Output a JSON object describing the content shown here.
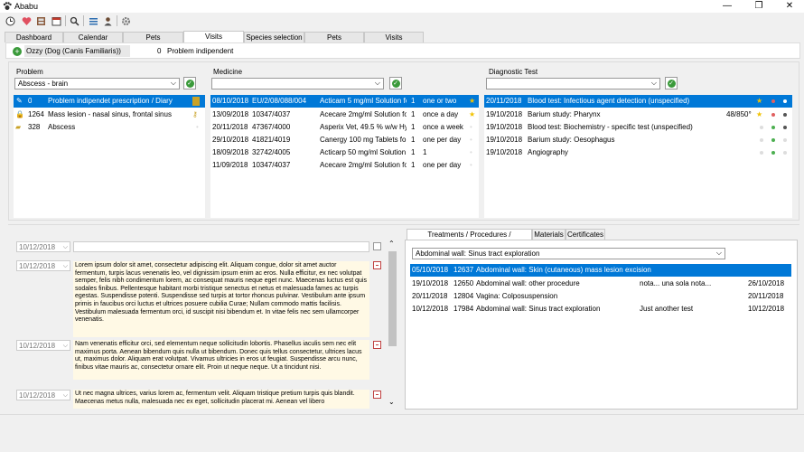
{
  "window": {
    "title": "Ababu",
    "min": "—",
    "max": "❐",
    "close": "✕"
  },
  "tabs": [
    "Dashboard",
    "Calendar",
    "Pets",
    "Visits",
    "Species selection",
    "Pets",
    "Visits"
  ],
  "patient": {
    "name": "Ozzy (Dog (Canis Familiaris))",
    "problem_id": "0",
    "problem": "Problem indipendent"
  },
  "problem": {
    "label": "Problem",
    "selected": "Abscess - brain",
    "rows": [
      {
        "id": "0",
        "name": "Problem indipendet prescription / Diary"
      },
      {
        "id": "1264",
        "name": "Mass lesion - nasal sinus, frontal sinus"
      },
      {
        "id": "328",
        "name": "Abscess"
      }
    ]
  },
  "medicine": {
    "label": "Medicine",
    "selected": "",
    "rows": [
      {
        "date": "08/10/2018",
        "code": "EU/2/08/088/004",
        "name": "Acticam 5 mg/ml Solution fo",
        "qty": "1",
        "freq": "one or two"
      },
      {
        "date": "13/09/2018",
        "code": "10347/4037",
        "name": "Acecare 2mg/ml Solution for I",
        "qty": "1",
        "freq": "once a day"
      },
      {
        "date": "20/11/2018",
        "code": "47367/4000",
        "name": "Asperix Vet, 49.5 % w/w Hyd",
        "qty": "1",
        "freq": "once a week"
      },
      {
        "date": "29/10/2018",
        "code": "41821/4019",
        "name": "Canergy 100 mg Tablets for",
        "qty": "1",
        "freq": "one per day"
      },
      {
        "date": "18/09/2018",
        "code": "32742/4005",
        "name": "Acticarp 50 mg/ml Solution fo",
        "qty": "1",
        "freq": "1"
      },
      {
        "date": "11/09/2018",
        "code": "10347/4037",
        "name": "Acecare 2mg/ml Solution for I",
        "qty": "1",
        "freq": "one per day"
      }
    ]
  },
  "diagnostic": {
    "label": "Diagnostic Test",
    "selected": "",
    "rows": [
      {
        "date": "20/11/2018",
        "name": "Blood test: Infectious agent detection (unspecified)",
        "value": ""
      },
      {
        "date": "19/10/2018",
        "name": "Barium study: Pharynx",
        "value": "48/850°"
      },
      {
        "date": "19/10/2018",
        "name": "Blood test: Biochemistry - specific test (unspecified)",
        "value": ""
      },
      {
        "date": "19/10/2018",
        "name": "Barium study: Oesophagus",
        "value": ""
      },
      {
        "date": "19/10/2018",
        "name": "Angiography",
        "value": ""
      }
    ]
  },
  "diary": {
    "entries": [
      {
        "date": "10/12/2018",
        "text": ""
      },
      {
        "date": "10/12/2018",
        "text": "Lorem ipsum dolor sit amet, consectetur adipiscing elit. Aliquam congue, dolor sit amet auctor fermentum, turpis lacus venenatis leo, vel dignissim ipsum enim ac eros. Nulla efficitur, ex nec volutpat semper, felis nibh condimentum lorem, ac consequat mauris neque eget nunc. Maecenas luctus est quis sodales finibus. Pellentesque habitant morbi tristique senectus et netus et malesuada fames ac turpis egestas. Suspendisse potenti. Suspendisse sed turpis at tortor rhoncus pulvinar. Vestibulum ante ipsum primis in faucibus orci luctus et ultrices posuere cubilia Curae; Nullam commodo mattis facilisis. Vestibulum malesuada fermentum orci, id suscipit nisi bibendum et. In vitae felis nec sem ullamcorper venenatis."
      },
      {
        "date": "10/12/2018",
        "text": "Nam venenatis efficitur orci, sed elementum neque sollicitudin lobortis. Phasellus iaculis sem nec elit maximus porta. Aenean bibendum quis nulla ut bibendum. Donec quis tellus consectetur, ultrices lacus ut, maximus dolor. Aliquam erat volutpat. Vivamus ultricies in eros ut feugiat. Suspendisse arcu nunc, finibus vitae mauris ac, consectetur ornare elit. Proin ut neque neque. Ut a tincidunt nisi."
      },
      {
        "date": "10/12/2018",
        "text": "Ut nec magna ultrices, varius lorem ac, fermentum velit. Aliquam tristique pretium turpis quis blandit. Maecenas metus nulla, malesuada nec ex eget, sollicitudin placerat mi. Aenean vel libero"
      }
    ]
  },
  "treatments": {
    "tabs": [
      "Treatments / Procedures / Vaccinations",
      "Materials",
      "Certificates"
    ],
    "selected": "Abdominal wall: Sinus tract exploration",
    "rows": [
      {
        "date": "05/10/2018",
        "code": "12637",
        "name": "Abdominal wall: Skin (cutaneous) mass lesion excision",
        "note": "",
        "date2": ""
      },
      {
        "date": "19/10/2018",
        "code": "12650",
        "name": "Abdominal wall: other procedure",
        "note": "nota... una sola nota...",
        "date2": "26/10/2018"
      },
      {
        "date": "20/11/2018",
        "code": "12804",
        "name": "Vagina: Colposuspension",
        "note": "",
        "date2": "20/11/2018"
      },
      {
        "date": "10/12/2018",
        "code": "17984",
        "name": "Abdominal wall: Sinus tract exploration",
        "note": "Just another test",
        "date2": "10/12/2018"
      }
    ]
  },
  "colors": {
    "selection": "#0078d7",
    "accent_green": "#3a9a3a",
    "note_bg": "#fff9e5",
    "star": "#f2c200"
  },
  "icons": [
    "clock-icon",
    "heart-icon",
    "cabinet-icon",
    "calendar-icon",
    "search-icon",
    "list-icon",
    "doctor-icon",
    "gear-icon"
  ]
}
